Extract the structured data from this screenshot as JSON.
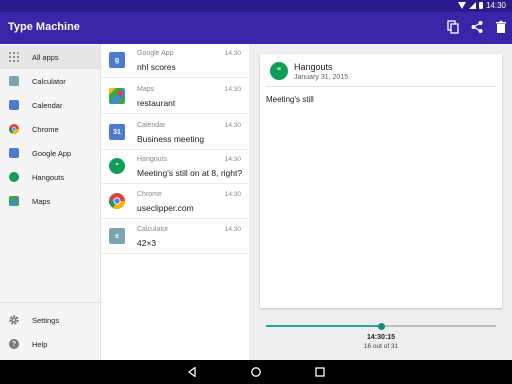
{
  "status": {
    "time": "14:30"
  },
  "appbar": {
    "title": "Type Machine",
    "actions": [
      {
        "icon": "copy-icon"
      },
      {
        "icon": "share-icon"
      },
      {
        "icon": "delete-icon"
      }
    ]
  },
  "sidebar": {
    "items": [
      {
        "label": "All apps",
        "icon": "grid-icon",
        "color": "#9e9e9e"
      },
      {
        "label": "Calculator",
        "icon": "calculator-icon",
        "color": "#7ca3b0"
      },
      {
        "label": "Calendar",
        "icon": "calendar-icon",
        "color": "#4a7bd0"
      },
      {
        "label": "Chrome",
        "icon": "chrome-icon",
        "color": "#db4437"
      },
      {
        "label": "Google App",
        "icon": "google-app-icon",
        "color": "#4a7bd0"
      },
      {
        "label": "Hangouts",
        "icon": "hangouts-icon",
        "color": "#0f9d58"
      },
      {
        "label": "Maps",
        "icon": "maps-icon",
        "color": "#34a853"
      }
    ],
    "footer": [
      {
        "label": "Settings",
        "icon": "gear-icon"
      },
      {
        "label": "Help",
        "icon": "help-icon"
      }
    ]
  },
  "notifications": [
    {
      "app": "Google App",
      "time": "14:30",
      "text": "nhl scores",
      "icon": "google-app-icon",
      "color": "#4a7bd0"
    },
    {
      "app": "Maps",
      "time": "14:30",
      "text": "restaurant",
      "icon": "maps-icon",
      "color": "#34a853"
    },
    {
      "app": "Calendar",
      "time": "14:30",
      "text": "Business meeting",
      "icon": "calendar-icon",
      "color": "#4a7bd0"
    },
    {
      "app": "Hangouts",
      "time": "14:30",
      "text": "Meeting's still on at 8, right?",
      "icon": "hangouts-icon",
      "color": "#0f9d58"
    },
    {
      "app": "Chrome",
      "time": "14:30",
      "text": "useclipper.com",
      "icon": "chrome-icon",
      "color": "#db4437"
    },
    {
      "app": "Calculator",
      "time": "14:30",
      "text": "42×3",
      "icon": "calculator-icon",
      "color": "#7ca3b0"
    }
  ],
  "detail": {
    "app": "Hangouts",
    "date": "January 31, 2015",
    "body": "Meeting's still"
  },
  "timeline": {
    "time": "14:30:15",
    "position_label": "16 out of 31",
    "position_fraction": 0.5
  },
  "colors": {
    "statusbar": "#2b1b8a",
    "appbar": "#3a24a8",
    "accent": "#26a69a"
  }
}
